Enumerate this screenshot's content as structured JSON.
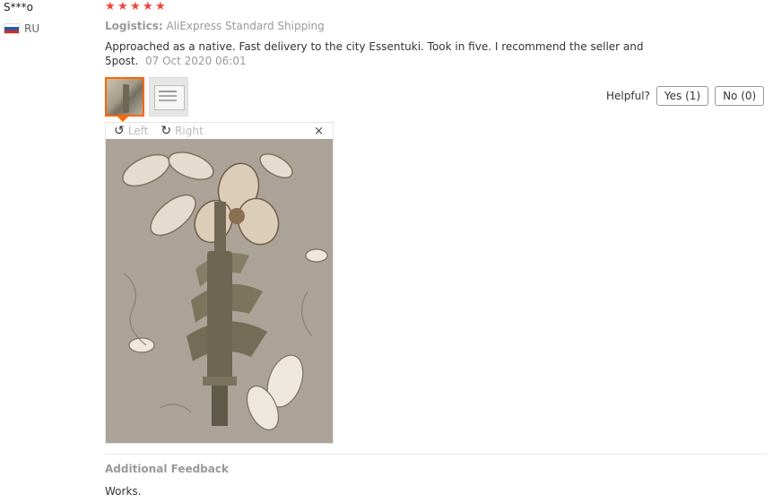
{
  "user": {
    "name": "S***o",
    "country": "RU",
    "flag_colors": [
      "#ffffff",
      "#2d58a7",
      "#d52b1e"
    ]
  },
  "rating": {
    "stars": 5,
    "star_color": "#f44336"
  },
  "logistics": {
    "label": "Logistics:",
    "value": "AliExpress Standard Shipping"
  },
  "review": {
    "text": "Approached as a native. Fast delivery to the city Essentuki. Took in five. I recommend the seller and 5post.",
    "date": "07 Oct 2020 06:01"
  },
  "photos": {
    "thumbnails": [
      "product-photo-auger",
      "product-photo-box"
    ],
    "active_index": 0
  },
  "viewer": {
    "rotate_left_label": "Left",
    "rotate_right_label": "Right",
    "close_symbol": "×"
  },
  "helpful": {
    "label": "Helpful?",
    "yes_label": "Yes (1)",
    "no_label": "No (0)"
  },
  "additional_feedback": {
    "title": "Additional Feedback",
    "text": "Works."
  },
  "colors": {
    "accent": "#ff6600"
  }
}
